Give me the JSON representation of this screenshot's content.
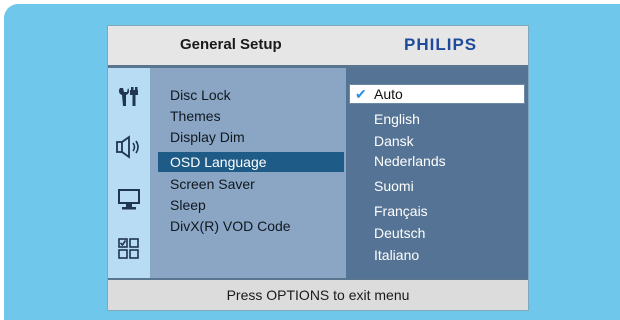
{
  "header": {
    "title": "General Setup",
    "brand": "PHILIPS"
  },
  "sidebar_icons": [
    "tools-icon",
    "speaker-icon",
    "monitor-icon",
    "grid-icon"
  ],
  "menu": {
    "items": [
      {
        "label": "Disc Lock"
      },
      {
        "label": "Themes"
      },
      {
        "label": "Display Dim"
      },
      {
        "label": "OSD Language",
        "selected": true
      },
      {
        "label": "Screen Saver"
      },
      {
        "label": "Sleep"
      },
      {
        "label": "DivX(R) VOD Code"
      }
    ]
  },
  "options": {
    "items": [
      {
        "label": "Auto",
        "selected": true
      },
      {
        "label": "English"
      },
      {
        "label": "Dansk"
      },
      {
        "label": "Nederlands"
      },
      {
        "label": "Suomi"
      },
      {
        "label": "Français"
      },
      {
        "label": "Deutsch"
      },
      {
        "label": "Italiano"
      }
    ],
    "scroll_indicator": "▼"
  },
  "footer": {
    "text": "Press OPTIONS to exit menu"
  },
  "colors": {
    "background": "#6fc8ec",
    "menu_bg": "#8aa6c4",
    "options_bg": "#557394",
    "selection": "#1e5b86",
    "brand": "#1f4a9a",
    "check": "#2a8ee6"
  }
}
